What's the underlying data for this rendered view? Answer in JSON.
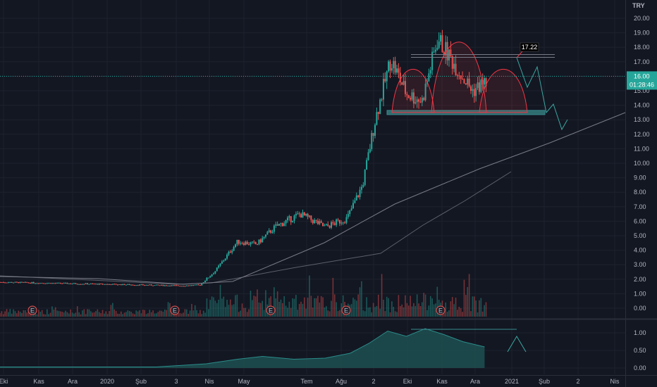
{
  "colors": {
    "background": "#131722",
    "up": "#26a69a",
    "down": "#ef5350",
    "grid": "#1e222d",
    "axis_text": "#b2b5be",
    "pattern": "#f23645",
    "neckline_fill": "#2e6b6e",
    "projection": "#3aa7a0",
    "ma": "#5d606b",
    "indicator_fill": "#1e4d4f",
    "current_price_bg": "#26a69a",
    "annotation_bg": "#000000"
  },
  "chart_data": [
    {
      "type": "candlestick",
      "title": "",
      "currency": "TRY",
      "y_ticks": [
        "0.00",
        "1.00",
        "2.00",
        "3.00",
        "4.00",
        "5.00",
        "6.00",
        "7.00",
        "8.00",
        "9.00",
        "10.00",
        "11.00",
        "12.00",
        "13.00",
        "14.00",
        "15.00",
        "16.00",
        "17.00",
        "18.00",
        "19.00",
        "20.00"
      ],
      "ylim": [
        0,
        20.5
      ],
      "x_ticks": [
        "Eki",
        "Kas",
        "Ara",
        "2020",
        "Şub",
        "3",
        "Nis",
        "May",
        "Tem",
        "Ağu",
        "2",
        "Eki",
        "Kas",
        "Ara",
        "2021",
        "Şub",
        "2",
        "Nis"
      ],
      "grid": true,
      "current_price": "16.00",
      "countdown": "01:28:46",
      "annotation_price": "17.22",
      "earnings_markers": [
        "E",
        "E",
        "E",
        "E",
        "E"
      ],
      "price_path": [
        [
          0,
          1.8
        ],
        [
          0.29,
          1.55
        ],
        [
          0.32,
          1.6
        ],
        [
          0.345,
          2.6
        ],
        [
          0.38,
          4.6
        ],
        [
          0.41,
          4.4
        ],
        [
          0.44,
          5.6
        ],
        [
          0.48,
          6.5
        ],
        [
          0.52,
          5.6
        ],
        [
          0.555,
          6.2
        ],
        [
          0.58,
          8.5
        ],
        [
          0.6,
          13.0
        ],
        [
          0.625,
          17.2
        ],
        [
          0.65,
          14.8
        ],
        [
          0.675,
          14.3
        ],
        [
          0.7,
          18.6
        ],
        [
          0.735,
          16.3
        ],
        [
          0.755,
          15.0
        ],
        [
          0.78,
          15.7
        ]
      ],
      "patterns": [
        {
          "name": "head-and-shoulders",
          "neckline": 13.5,
          "left_shoulder": 17.0,
          "head": 19.5,
          "right_shoulder": 17.0
        },
        {
          "name": "resistance",
          "value": 17.4
        }
      ]
    },
    {
      "type": "area",
      "title": "",
      "y_ticks": [
        "0.00",
        "0.50",
        "1.00"
      ],
      "ylim": [
        -0.05,
        1.25
      ],
      "grid": true,
      "series_path": [
        [
          0,
          0.03
        ],
        [
          0.25,
          0.03
        ],
        [
          0.33,
          0.12
        ],
        [
          0.38,
          0.25
        ],
        [
          0.42,
          0.33
        ],
        [
          0.47,
          0.25
        ],
        [
          0.52,
          0.28
        ],
        [
          0.56,
          0.42
        ],
        [
          0.59,
          0.7
        ],
        [
          0.62,
          1.05
        ],
        [
          0.65,
          0.9
        ],
        [
          0.68,
          1.12
        ],
        [
          0.71,
          0.95
        ],
        [
          0.74,
          0.75
        ],
        [
          0.775,
          0.6
        ]
      ]
    }
  ]
}
